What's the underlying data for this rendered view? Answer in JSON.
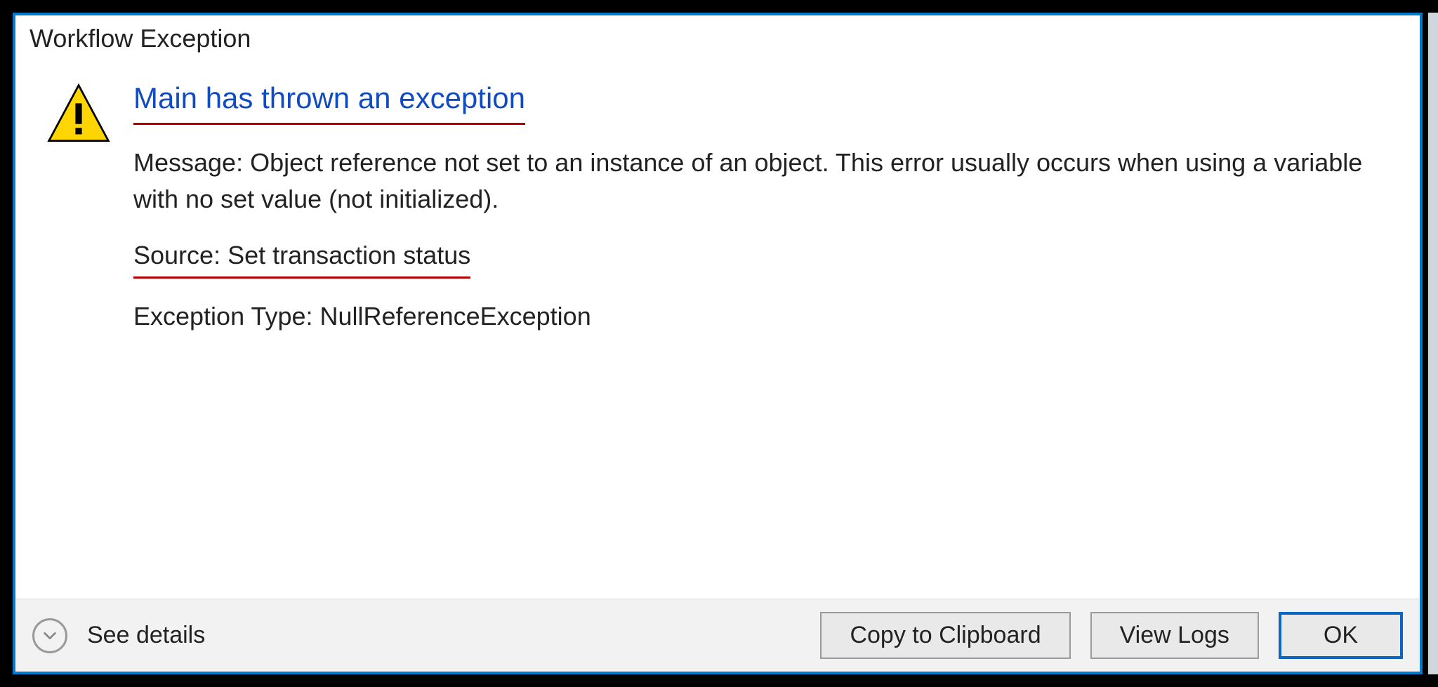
{
  "dialog": {
    "title": "Workflow Exception",
    "headline": "Main has thrown an exception",
    "message": "Message: Object reference not set to an instance of an object. This error usually occurs when using a variable with no set value (not initialized).",
    "source": "Source: Set transaction status",
    "exception_type": "Exception Type: NullReferenceException"
  },
  "footer": {
    "see_details": "See details",
    "copy": "Copy to Clipboard",
    "view_logs": "View Logs",
    "ok": "OK"
  }
}
